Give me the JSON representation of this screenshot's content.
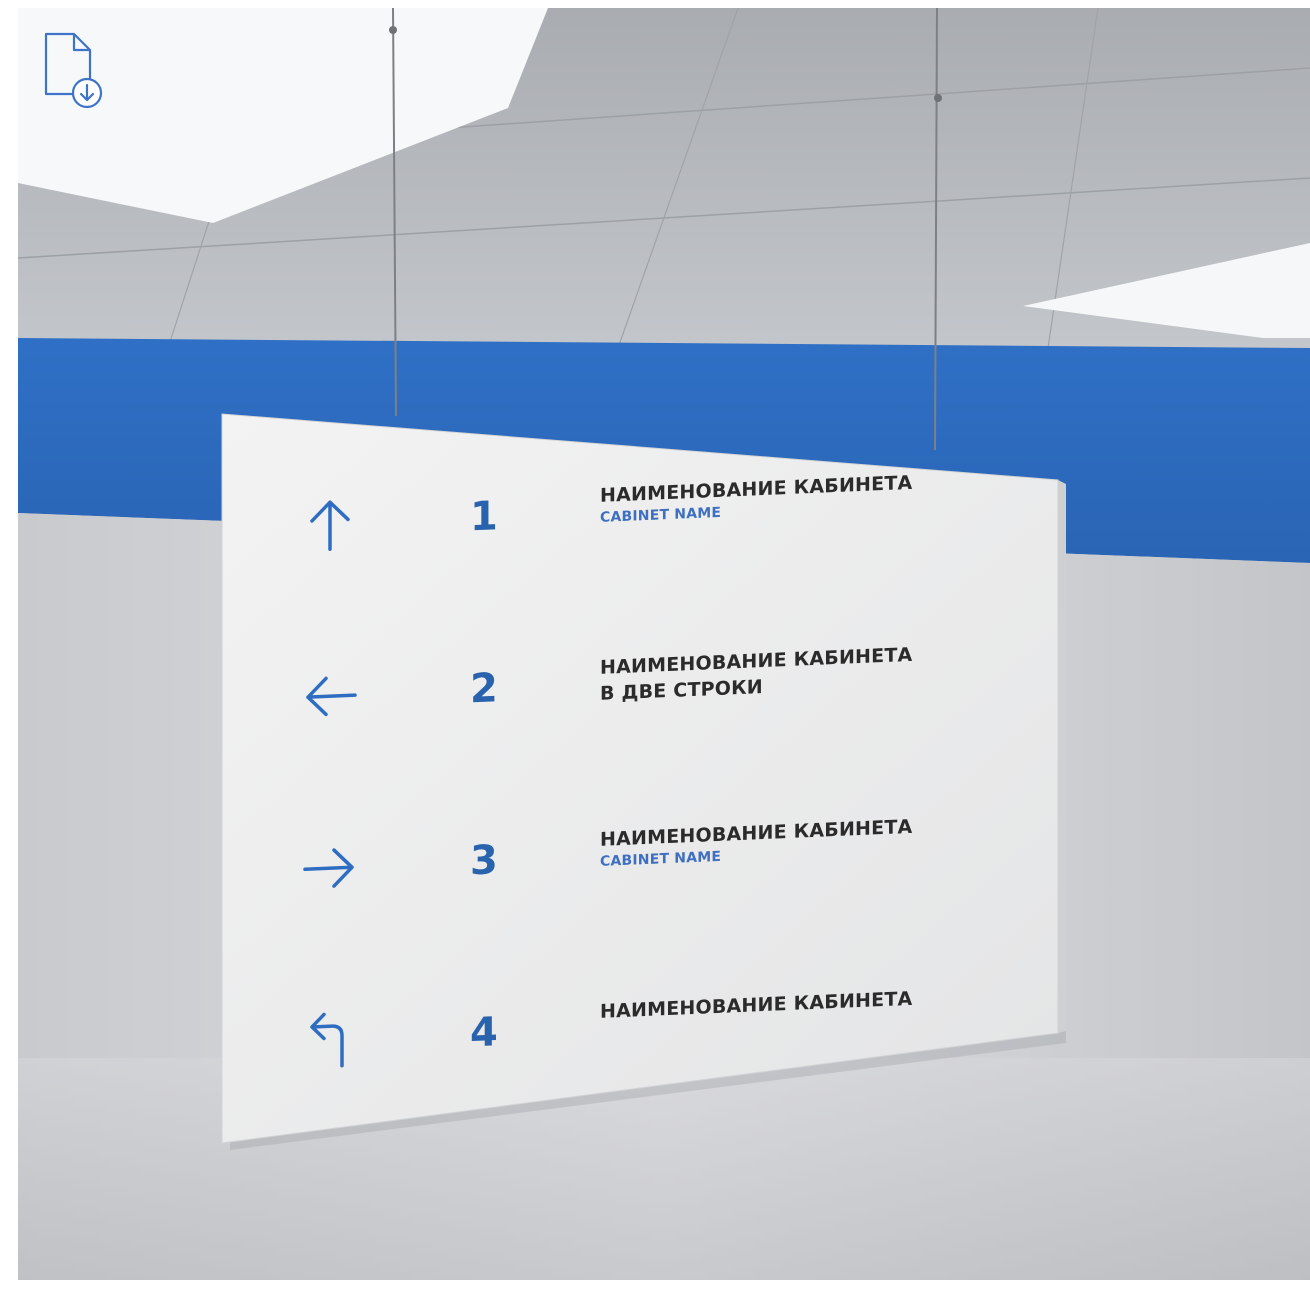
{
  "toolbar": {
    "download_icon": "file-download-icon"
  },
  "sign": {
    "rows": [
      {
        "icon": "arrow-up-icon",
        "number": "1",
        "name": "НАИМЕНОВАНИЕ КАБИНЕТА",
        "subname": "CABINET NAME",
        "name_line2": ""
      },
      {
        "icon": "arrow-left-icon",
        "number": "2",
        "name": "НАИМЕНОВАНИЕ КАБИНЕТА",
        "subname": "",
        "name_line2": "В ДВЕ СТРОКИ"
      },
      {
        "icon": "arrow-right-icon",
        "number": "3",
        "name": "НАИМЕНОВАНИЕ КАБИНЕТА",
        "subname": "CABINET NAME",
        "name_line2": ""
      },
      {
        "icon": "arrow-turn-left-icon",
        "number": "4",
        "name": "НАИМЕНОВАНИЕ КАБИНЕТА",
        "subname": "",
        "name_line2": ""
      }
    ]
  },
  "colors": {
    "accent_blue": "#2e6dc2",
    "sign_text": "#2b2b2b",
    "wall": "#c9cbcf",
    "ceiling": "#b9bcc1",
    "sign_face": "#ececec"
  }
}
